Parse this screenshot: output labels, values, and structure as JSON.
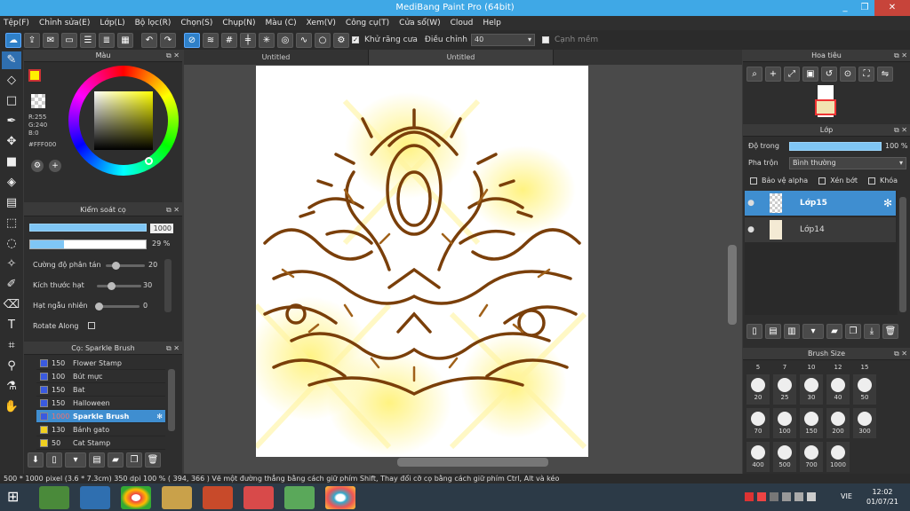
{
  "window": {
    "title": "MediBang Paint Pro (64bit)",
    "minimize": "_",
    "restore": "❐",
    "close": "✕"
  },
  "menu": [
    "Tệp(F)",
    "Chỉnh sửa(E)",
    "Lớp(L)",
    "Bộ lọc(R)",
    "Chọn(S)",
    "Chụp(N)",
    "Màu (C)",
    "Xem(V)",
    "Công cụ(T)",
    "Cửa sổ(W)",
    "Cloud",
    "Help"
  ],
  "toolbar": {
    "antialias_label": "Khử răng cưa",
    "correction_label": "Điều chỉnh",
    "correction_value": "40",
    "edge_label": "Cạnh mềm"
  },
  "tabs": [
    "Untitled",
    "Untitled"
  ],
  "color_panel": {
    "title": "Màu",
    "r": "R:255",
    "g": "G:240",
    "b": "B:0",
    "hex": "#FFF000",
    "primary_color": "#FFF000",
    "secondary_color": "#4a78c8"
  },
  "brush_control": {
    "title": "Kiểm soát cọ",
    "size_value": "1000",
    "opacity_value": "29 %",
    "opacity_fraction": 0.29,
    "params": [
      {
        "label": "Cường độ phân tán",
        "value": "20",
        "fraction": 0.2
      },
      {
        "label": "Kích thước hạt",
        "value": "30",
        "fraction": 0.3
      },
      {
        "label": "Hạt ngẫu nhiên",
        "value": "0",
        "fraction": 0.0
      }
    ],
    "rotate_label": "Rotate Along"
  },
  "brush_list": {
    "title": "Cọ: Sparkle Brush",
    "items": [
      {
        "size": "150",
        "name": "Flower Stamp",
        "color": "#3a5ae0"
      },
      {
        "size": "100",
        "name": "Bút mực",
        "color": "#3a5ae0"
      },
      {
        "size": "150",
        "name": "Bat",
        "color": "#3a5ae0"
      },
      {
        "size": "150",
        "name": "Halloween",
        "color": "#3a5ae0"
      },
      {
        "size": "1000",
        "name": "Sparkle Brush",
        "color": "#3a5ae0"
      },
      {
        "size": "130",
        "name": "Bánh gato",
        "color": "#f0d020"
      },
      {
        "size": "50",
        "name": "Cat Stamp",
        "color": "#f0d020"
      }
    ]
  },
  "navigator": {
    "title": "Hoa tiêu"
  },
  "layers": {
    "title": "Lớp",
    "opacity_label": "Độ trong",
    "opacity_value": "100 %",
    "blend_label": "Pha trộn",
    "blend_value": "Bình thường",
    "alpha_protect": "Bảo vệ alpha",
    "clipping": "Xén bớt",
    "lock": "Khóa",
    "items": [
      {
        "name": "Lớp15",
        "selected": true
      },
      {
        "name": "Lớp14",
        "selected": false
      }
    ]
  },
  "brush_size": {
    "title": "Brush Size",
    "top": [
      "5",
      "7",
      "10",
      "12",
      "15"
    ],
    "rows": [
      [
        "20",
        "25",
        "30",
        "40",
        "50"
      ],
      [
        "70",
        "100",
        "150",
        "200",
        "300"
      ],
      [
        "400",
        "500",
        "700",
        "1000"
      ]
    ]
  },
  "status": {
    "text": "500 * 1000 pixel   (3.6 * 7.3cm)   350 dpi   100 %   ( 394, 366 )   Vẽ một đường thẳng bằng cách giữ phím Shift, Thay đổi cỡ cọ bằng cách giữ phím Ctrl, Alt và kéo"
  },
  "taskbar": {
    "lang": "VIE",
    "time": "12:02",
    "date": "01/07/21"
  }
}
